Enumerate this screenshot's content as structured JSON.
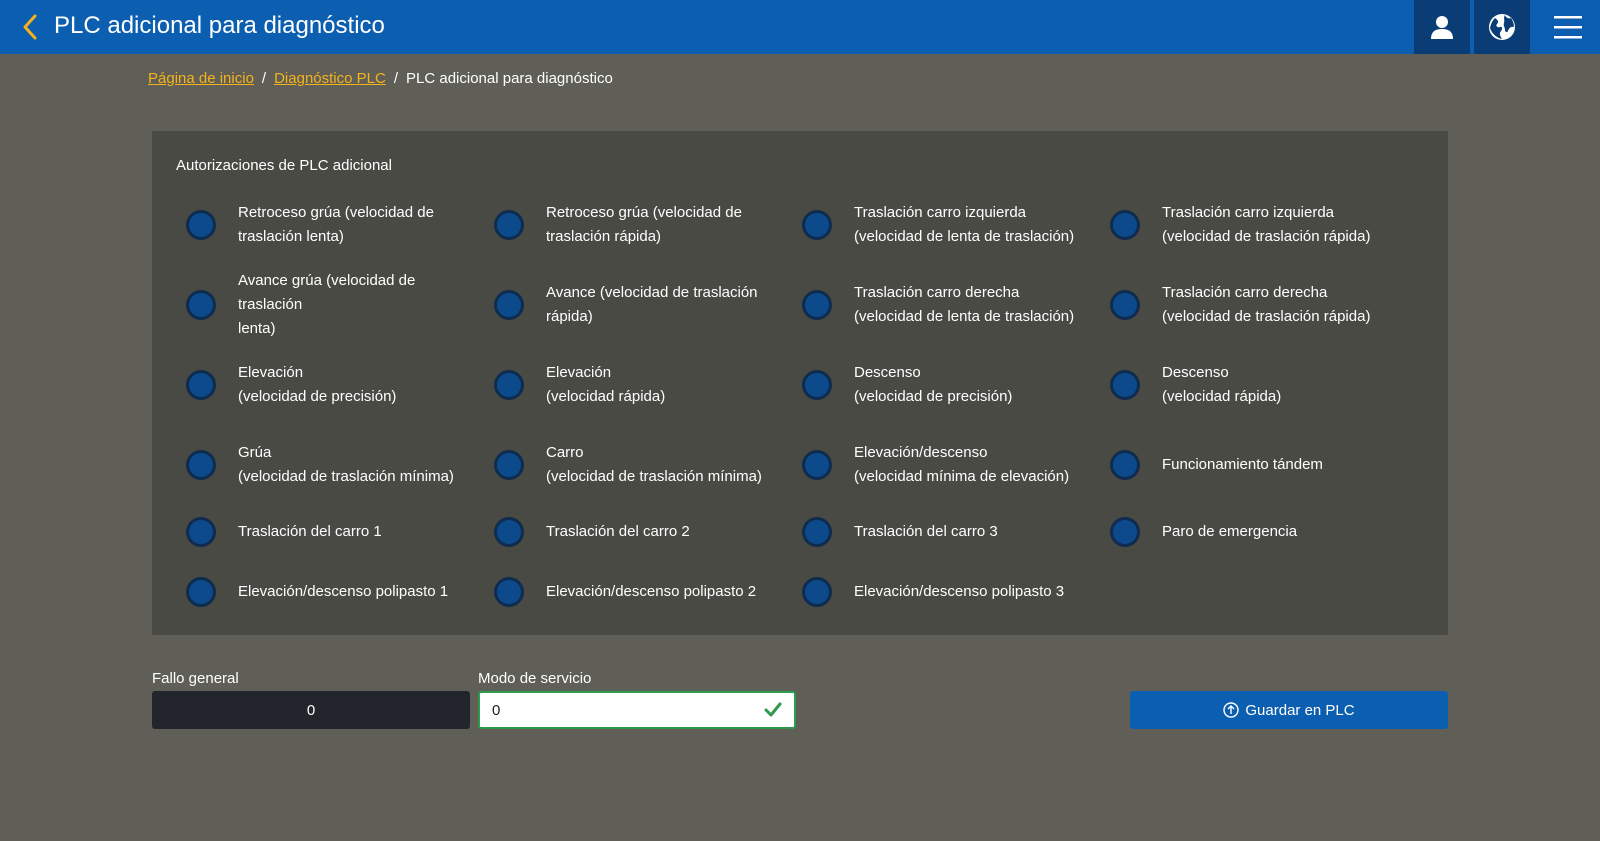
{
  "header": {
    "title": "PLC adicional para diagnóstico",
    "back_icon": "chevron-left-icon",
    "user_icon": "user-icon",
    "globe_icon": "globe-icon",
    "menu_icon": "hamburger-menu-icon"
  },
  "breadcrumb": {
    "home": "Página de inicio",
    "sep1": "/",
    "diag": "Diagnóstico PLC",
    "sep2": "/",
    "current": "PLC adicional para diagnóstico"
  },
  "panel": {
    "title": "Autorizaciones de PLC adicional",
    "items": [
      "Retroceso grúa (velocidad de\ntraslación lenta)",
      "Retroceso grúa (velocidad de\ntraslación rápida)",
      "Traslación carro izquierda\n(velocidad de lenta de traslación)",
      "Traslación carro izquierda\n(velocidad de traslación rápida)",
      "Avance grúa (velocidad de traslación\nlenta)",
      "Avance (velocidad de traslación\nrápida)",
      "Traslación carro derecha\n(velocidad de lenta de traslación)",
      "Traslación carro derecha\n(velocidad de traslación rápida)",
      "Elevación\n(velocidad de precisión)",
      "Elevación\n(velocidad rápida)",
      "Descenso\n(velocidad de precisión)",
      "Descenso\n(velocidad rápida)",
      "Grúa\n(velocidad de traslación mínima)",
      "Carro\n(velocidad de traslación mínima)",
      "Elevación/descenso\n(velocidad mínima de elevación)",
      "Funcionamiento tándem",
      "Traslación del carro 1",
      "Traslación del carro 2",
      "Traslación del carro 3",
      "Paro de emergencia",
      "Elevación/descenso polipasto 1",
      "Elevación/descenso polipasto 2",
      "Elevación/descenso polipasto 3"
    ],
    "led_color": "#0c4a8c"
  },
  "fields": {
    "fallo_label": "Fallo general",
    "fallo_value": "0",
    "modo_label": "Modo de servicio",
    "modo_value": "0"
  },
  "actions": {
    "save_label": "Guardar en PLC",
    "save_icon": "upload-circle-icon"
  },
  "colors": {
    "header": "#0c5fb0",
    "accent_link": "#f6b21b",
    "valid": "#2e9a4d"
  }
}
